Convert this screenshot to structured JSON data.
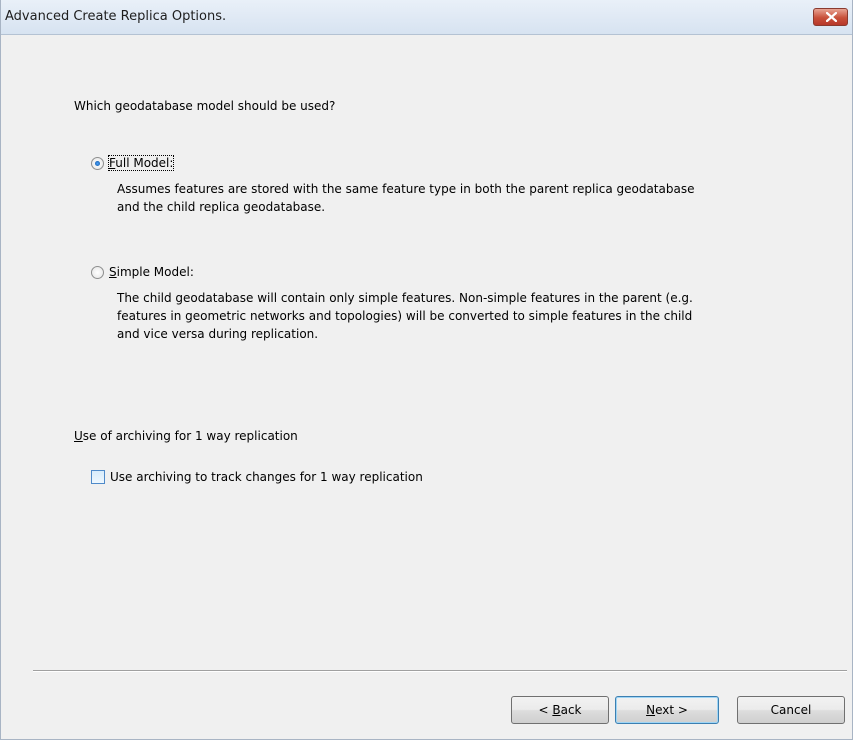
{
  "window": {
    "title": "Advanced Create Replica Options.",
    "close_icon": "close-x-icon"
  },
  "model": {
    "question": "Which geodatabase model should be used?",
    "options": [
      {
        "label": "Full Model:",
        "accesskey": "F",
        "selected": true,
        "description_lines": [
          "Assumes features are stored with the same feature type in both the parent replica geodatabase",
          "and the child replica geodatabase."
        ]
      },
      {
        "label": "Simple Model:",
        "accesskey": "S",
        "selected": false,
        "description_lines": [
          "The child geodatabase will contain only simple features. Non-simple features in the parent (e.g.",
          "features in geometric networks and topologies) will be converted to simple features in the child",
          "and vice versa during replication."
        ]
      }
    ]
  },
  "archiving": {
    "group_label": "Use of archiving for 1 way replication",
    "checkbox_label": "Use archiving to track changes for 1 way replication",
    "checked": false
  },
  "buttons": {
    "back": "< Back",
    "next": "Next >",
    "cancel": "Cancel"
  },
  "colors": {
    "window_bg": "#f0f0f0",
    "close_button": "#c8503a",
    "default_button_border": "#3c7fb1"
  }
}
